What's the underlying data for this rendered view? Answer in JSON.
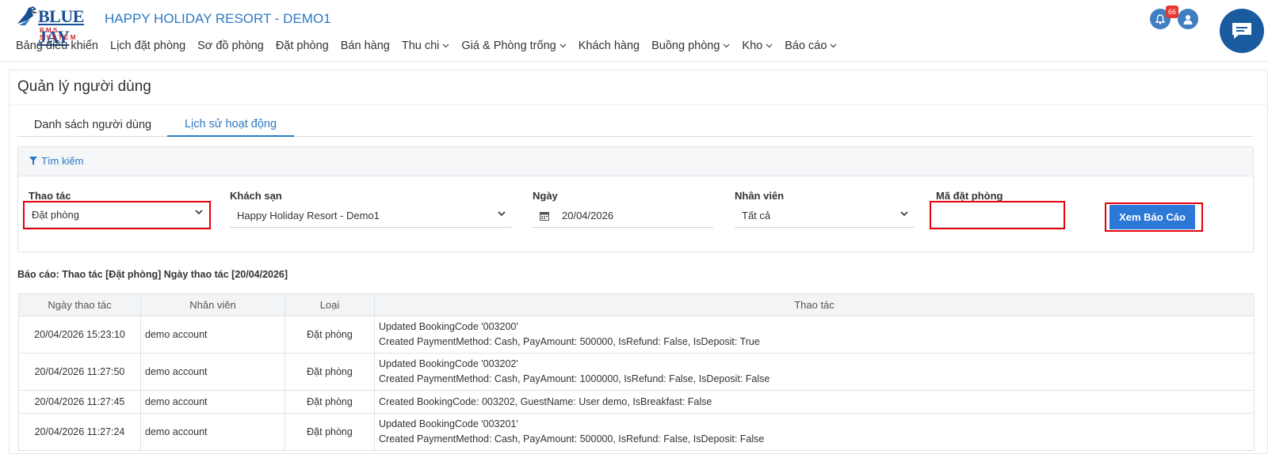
{
  "app": {
    "logo_text": "BLUE JAY",
    "logo_sub": "PMS SYSTEM",
    "title": "HAPPY HOLIDAY RESORT - DEMO1",
    "notification_count": "66"
  },
  "menu": [
    {
      "label": "Bảng điều khiển",
      "dropdown": false
    },
    {
      "label": "Lịch đặt phòng",
      "dropdown": false
    },
    {
      "label": "Sơ đồ phòng",
      "dropdown": false
    },
    {
      "label": "Đặt phòng",
      "dropdown": false
    },
    {
      "label": "Bán hàng",
      "dropdown": false
    },
    {
      "label": "Thu chi",
      "dropdown": true
    },
    {
      "label": "Giá & Phòng trống",
      "dropdown": true
    },
    {
      "label": "Khách hàng",
      "dropdown": false
    },
    {
      "label": "Buồng phòng",
      "dropdown": true
    },
    {
      "label": "Kho",
      "dropdown": true
    },
    {
      "label": "Báo cáo",
      "dropdown": true
    }
  ],
  "page": {
    "title": "Quản lý người dùng",
    "tabs": [
      {
        "label": "Danh sách người dùng",
        "active": false
      },
      {
        "label": "Lịch sử hoạt động",
        "active": true
      }
    ]
  },
  "search": {
    "header": "Tìm kiếm",
    "fields": {
      "action": {
        "label": "Thao tác",
        "value": "Đặt phòng"
      },
      "hotel": {
        "label": "Khách sạn",
        "value": "Happy Holiday Resort - Demo1"
      },
      "date": {
        "label": "Ngày",
        "value": "20/04/2026"
      },
      "staff": {
        "label": "Nhân viên",
        "value": "Tất cả"
      },
      "booking_code": {
        "label": "Mã đặt phòng",
        "value": ""
      }
    },
    "submit_label": "Xem Báo Cáo"
  },
  "report": {
    "caption": "Báo cáo: Thao tác [Đặt phòng] Ngày thao tác [20/04/2026]",
    "columns": [
      "Ngày thao tác",
      "Nhân viên",
      "Loại",
      "Thao tác"
    ],
    "rows": [
      {
        "date": "20/04/2026 15:23:10",
        "staff": "demo account",
        "type": "Đặt phòng",
        "lines": [
          "Updated BookingCode '003200'",
          "Created PaymentMethod: Cash, PayAmount: 500000, IsRefund: False, IsDeposit: True"
        ]
      },
      {
        "date": "20/04/2026 11:27:50",
        "staff": "demo account",
        "type": "Đặt phòng",
        "lines": [
          "Updated BookingCode '003202'",
          "Created PaymentMethod: Cash, PayAmount: 1000000, IsRefund: False, IsDeposit: False"
        ]
      },
      {
        "date": "20/04/2026 11:27:45",
        "staff": "demo account",
        "type": "Đặt phòng",
        "lines": [
          "Created BookingCode: 003202, GuestName: User demo, IsBreakfast: False"
        ]
      },
      {
        "date": "20/04/2026 11:27:24",
        "staff": "demo account",
        "type": "Đặt phòng",
        "lines": [
          "Updated BookingCode '003201'",
          "Created PaymentMethod: Cash, PayAmount: 500000, IsRefund: False, IsDeposit: False"
        ]
      }
    ]
  }
}
